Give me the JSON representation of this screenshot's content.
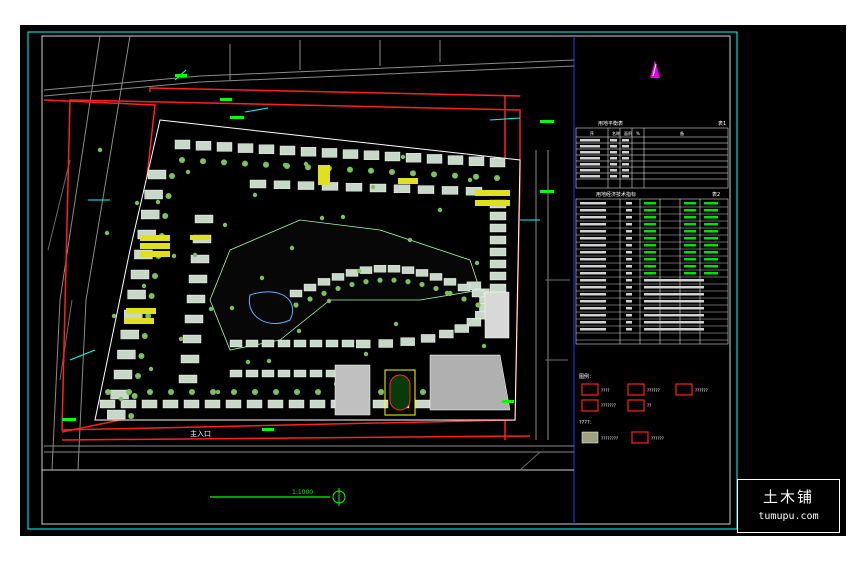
{
  "drawing": {
    "scale_label": "1:1000",
    "entrance_label": "主入口",
    "table1": {
      "title": "用地平衡表",
      "tag": "表1",
      "header": [
        "序",
        "名称",
        "面积",
        "%",
        "备"
      ]
    },
    "table2": {
      "title": "用地经济技术指标",
      "tag": "表2"
    },
    "legend_head_1": "图例：",
    "legend_items": [
      "????",
      "??????",
      "??????",
      "???????",
      "??"
    ],
    "legend_head_2": "????：",
    "legend_bottom": [
      "????????",
      "??????"
    ]
  },
  "colors": {
    "background": "#000000",
    "frame": "#ffffff",
    "cyan": "#00ffff",
    "road": "#ff2020",
    "building": "#c8d8c8",
    "tree": "#8cc870",
    "yellow": "#ffff00",
    "green": "#00ff00",
    "blue_line": "#2020ff"
  },
  "watermark": {
    "name": "土木铺",
    "url": "tumupu.com"
  }
}
